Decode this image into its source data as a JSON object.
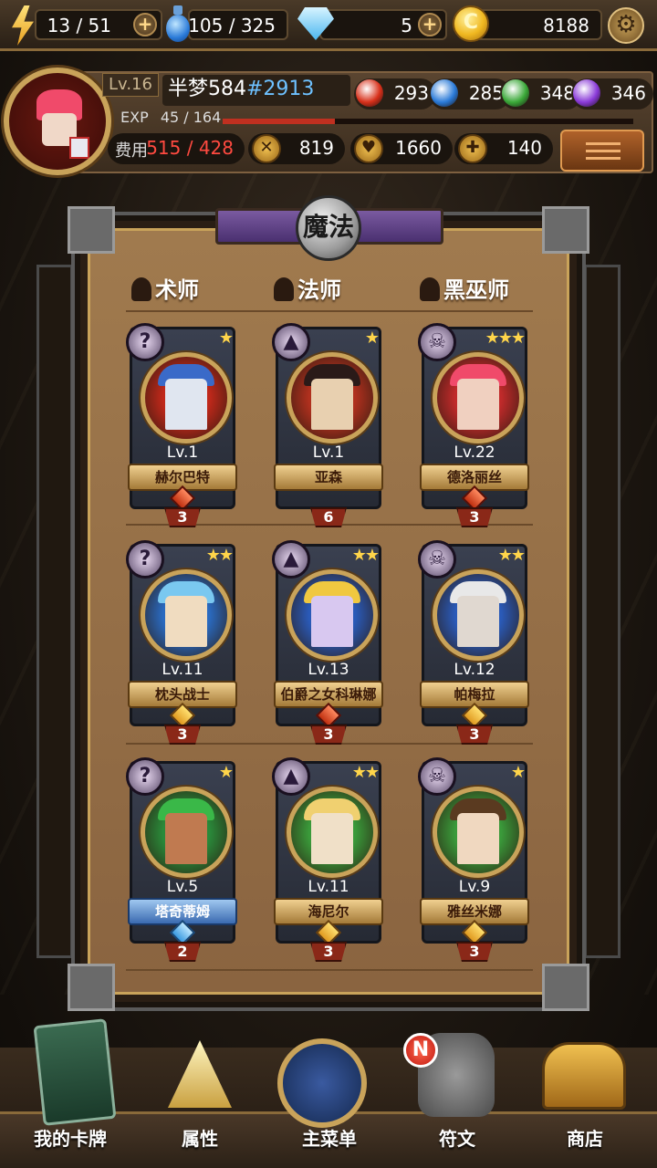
{
  "topbar": {
    "energy": "13 / 51",
    "potion": "105 / 325",
    "gems": "5",
    "gold": "8188",
    "coin_glyph": "C",
    "plus_glyph": "+",
    "settings_glyph": "⚙"
  },
  "profile": {
    "level": "Lv.16",
    "name": "半梦584",
    "id": "#2913",
    "exp_label": "EXP",
    "exp_value": "45 / 164",
    "exp_fraction": 0.274,
    "cost_label": "费用",
    "cost_value": "515 / 428",
    "attack": "819",
    "health": "1660",
    "heal": "140",
    "orbs": [
      {
        "value": "293",
        "color": "#d8301a"
      },
      {
        "value": "285",
        "color": "#2a7ad8"
      },
      {
        "value": "348",
        "color": "#3aa838"
      },
      {
        "value": "346",
        "color": "#8a3ad8"
      }
    ]
  },
  "panel": {
    "title": "魔法",
    "columns": [
      "术师",
      "法师",
      "黑巫师"
    ]
  },
  "cards": [
    {
      "level": "Lv.1",
      "name": "赫尔巴特",
      "stars": "★",
      "count": "3",
      "badge": "?",
      "ring": "#c0281a",
      "hero": "#e0e6f0",
      "hat": "#3a6ac8",
      "rarity": "red",
      "plate": "gold"
    },
    {
      "level": "Lv.1",
      "name": "亚森",
      "stars": "★",
      "count": "6",
      "badge": "▲",
      "ring": "#b0301e",
      "hero": "#e8d0b0",
      "hat": "#2a1a18",
      "rarity": "none",
      "plate": "gold"
    },
    {
      "level": "Lv.22",
      "name": "德洛丽丝",
      "stars": "★★★",
      "count": "3",
      "badge": "☠",
      "ring": "#c02a2a",
      "hero": "#f0d0c0",
      "hat": "#f04a6a",
      "rarity": "red",
      "plate": "gold"
    },
    {
      "level": "Lv.11",
      "name": "枕头战士",
      "stars": "★★",
      "count": "3",
      "badge": "?",
      "ring": "#2a6ac0",
      "hero": "#f0dcc0",
      "hat": "#7ac8f0",
      "rarity": "gold",
      "plate": "gold"
    },
    {
      "level": "Lv.13",
      "name": "伯爵之女科琳娜",
      "stars": "★★",
      "count": "3",
      "badge": "▲",
      "ring": "#2a5ab8",
      "hero": "#d8c8f0",
      "hat": "#f0c840",
      "rarity": "red",
      "plate": "gold"
    },
    {
      "level": "Lv.12",
      "name": "帕梅拉",
      "stars": "★★",
      "count": "3",
      "badge": "☠",
      "ring": "#2a5ab8",
      "hero": "#e0d8d0",
      "hat": "#e8e8e8",
      "rarity": "gold",
      "plate": "gold"
    },
    {
      "level": "Lv.5",
      "name": "塔奇蒂姆",
      "stars": "★",
      "count": "2",
      "badge": "?",
      "ring": "#2a8a3a",
      "hero": "#c07a50",
      "hat": "#3ab848",
      "rarity": "blue",
      "plate": "blue"
    },
    {
      "level": "Lv.11",
      "name": "海尼尔",
      "stars": "★★",
      "count": "3",
      "badge": "▲",
      "ring": "#3a9a3a",
      "hero": "#f0e0c8",
      "hat": "#f0d070",
      "rarity": "gold",
      "plate": "gold"
    },
    {
      "level": "Lv.9",
      "name": "雅丝米娜",
      "stars": "★",
      "count": "3",
      "badge": "☠",
      "ring": "#3a9a3a",
      "hero": "#f0d8c0",
      "hat": "#5a3a20",
      "rarity": "gold",
      "plate": "gold"
    }
  ],
  "nav": {
    "my_cards": "我的卡牌",
    "attributes": "属性",
    "main_menu": "主菜单",
    "runes": "符文",
    "shop": "商店",
    "new_badge": "N"
  }
}
